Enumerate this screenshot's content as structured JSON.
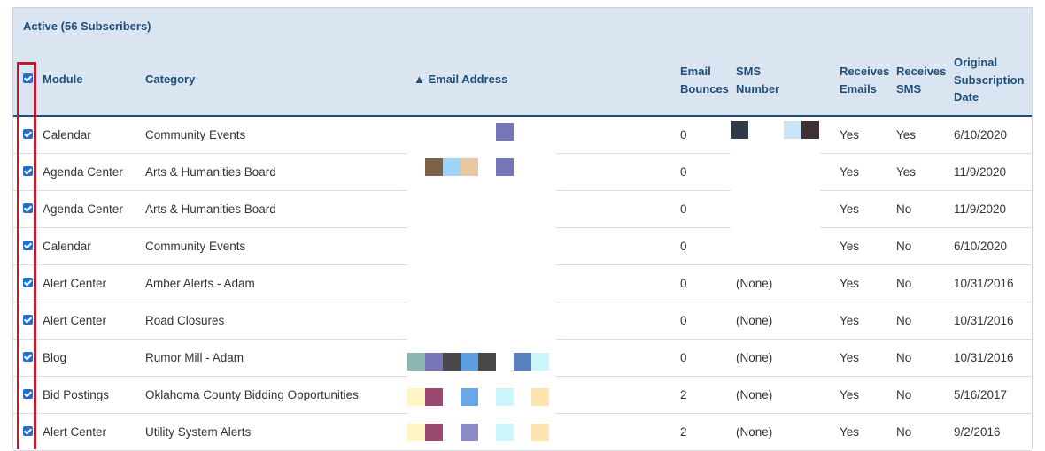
{
  "section_title": "Active (56 Subscribers)",
  "headers": {
    "module": "Module",
    "category": "Category",
    "email_address": "▲ Email Address",
    "email_bounces": [
      "Email",
      "Bounces"
    ],
    "sms_number": [
      "SMS",
      "Number"
    ],
    "receives_emails": [
      "Receives",
      "Emails"
    ],
    "receives_sms": [
      "Receives",
      "SMS"
    ],
    "original_date": [
      "Original",
      "Subscription",
      "Date"
    ]
  },
  "rows": [
    {
      "module": "Calendar",
      "category": "Community Events",
      "bounces": "0",
      "sms": "",
      "emails": "Yes",
      "receives_sms": "Yes",
      "date": "6/10/2020"
    },
    {
      "module": "Agenda Center",
      "category": "Arts & Humanities Board",
      "bounces": "0",
      "sms": "",
      "emails": "Yes",
      "receives_sms": "Yes",
      "date": "11/9/2020"
    },
    {
      "module": "Agenda Center",
      "category": "Arts & Humanities Board",
      "bounces": "0",
      "sms": "",
      "emails": "Yes",
      "receives_sms": "No",
      "date": "11/9/2020"
    },
    {
      "module": "Calendar",
      "category": "Community Events",
      "bounces": "0",
      "sms": "",
      "emails": "Yes",
      "receives_sms": "No",
      "date": "6/10/2020"
    },
    {
      "module": "Alert Center",
      "category": "Amber Alerts - Adam",
      "bounces": "0",
      "sms": "(None)",
      "emails": "Yes",
      "receives_sms": "No",
      "date": "10/31/2016"
    },
    {
      "module": "Alert Center",
      "category": "Road Closures",
      "bounces": "0",
      "sms": "(None)",
      "emails": "Yes",
      "receives_sms": "No",
      "date": "10/31/2016"
    },
    {
      "module": "Blog",
      "category": "Rumor Mill - Adam",
      "bounces": "0",
      "sms": "(None)",
      "emails": "Yes",
      "receives_sms": "No",
      "date": "10/31/2016"
    },
    {
      "module": "Bid Postings",
      "category": "Oklahoma County Bidding Opportunities",
      "bounces": "2",
      "sms": "(None)",
      "emails": "Yes",
      "receives_sms": "No",
      "date": "5/16/2017"
    },
    {
      "module": "Alert Center",
      "category": "Utility System Alerts",
      "bounces": "2",
      "sms": "(None)",
      "emails": "Yes",
      "receives_sms": "No",
      "date": "9/2/2016"
    }
  ],
  "colors": {
    "header_bg": "#dbe5f1",
    "header_text": "#1f4e79",
    "checkbox": "#1f6fd0",
    "highlight": "#c0192c"
  }
}
